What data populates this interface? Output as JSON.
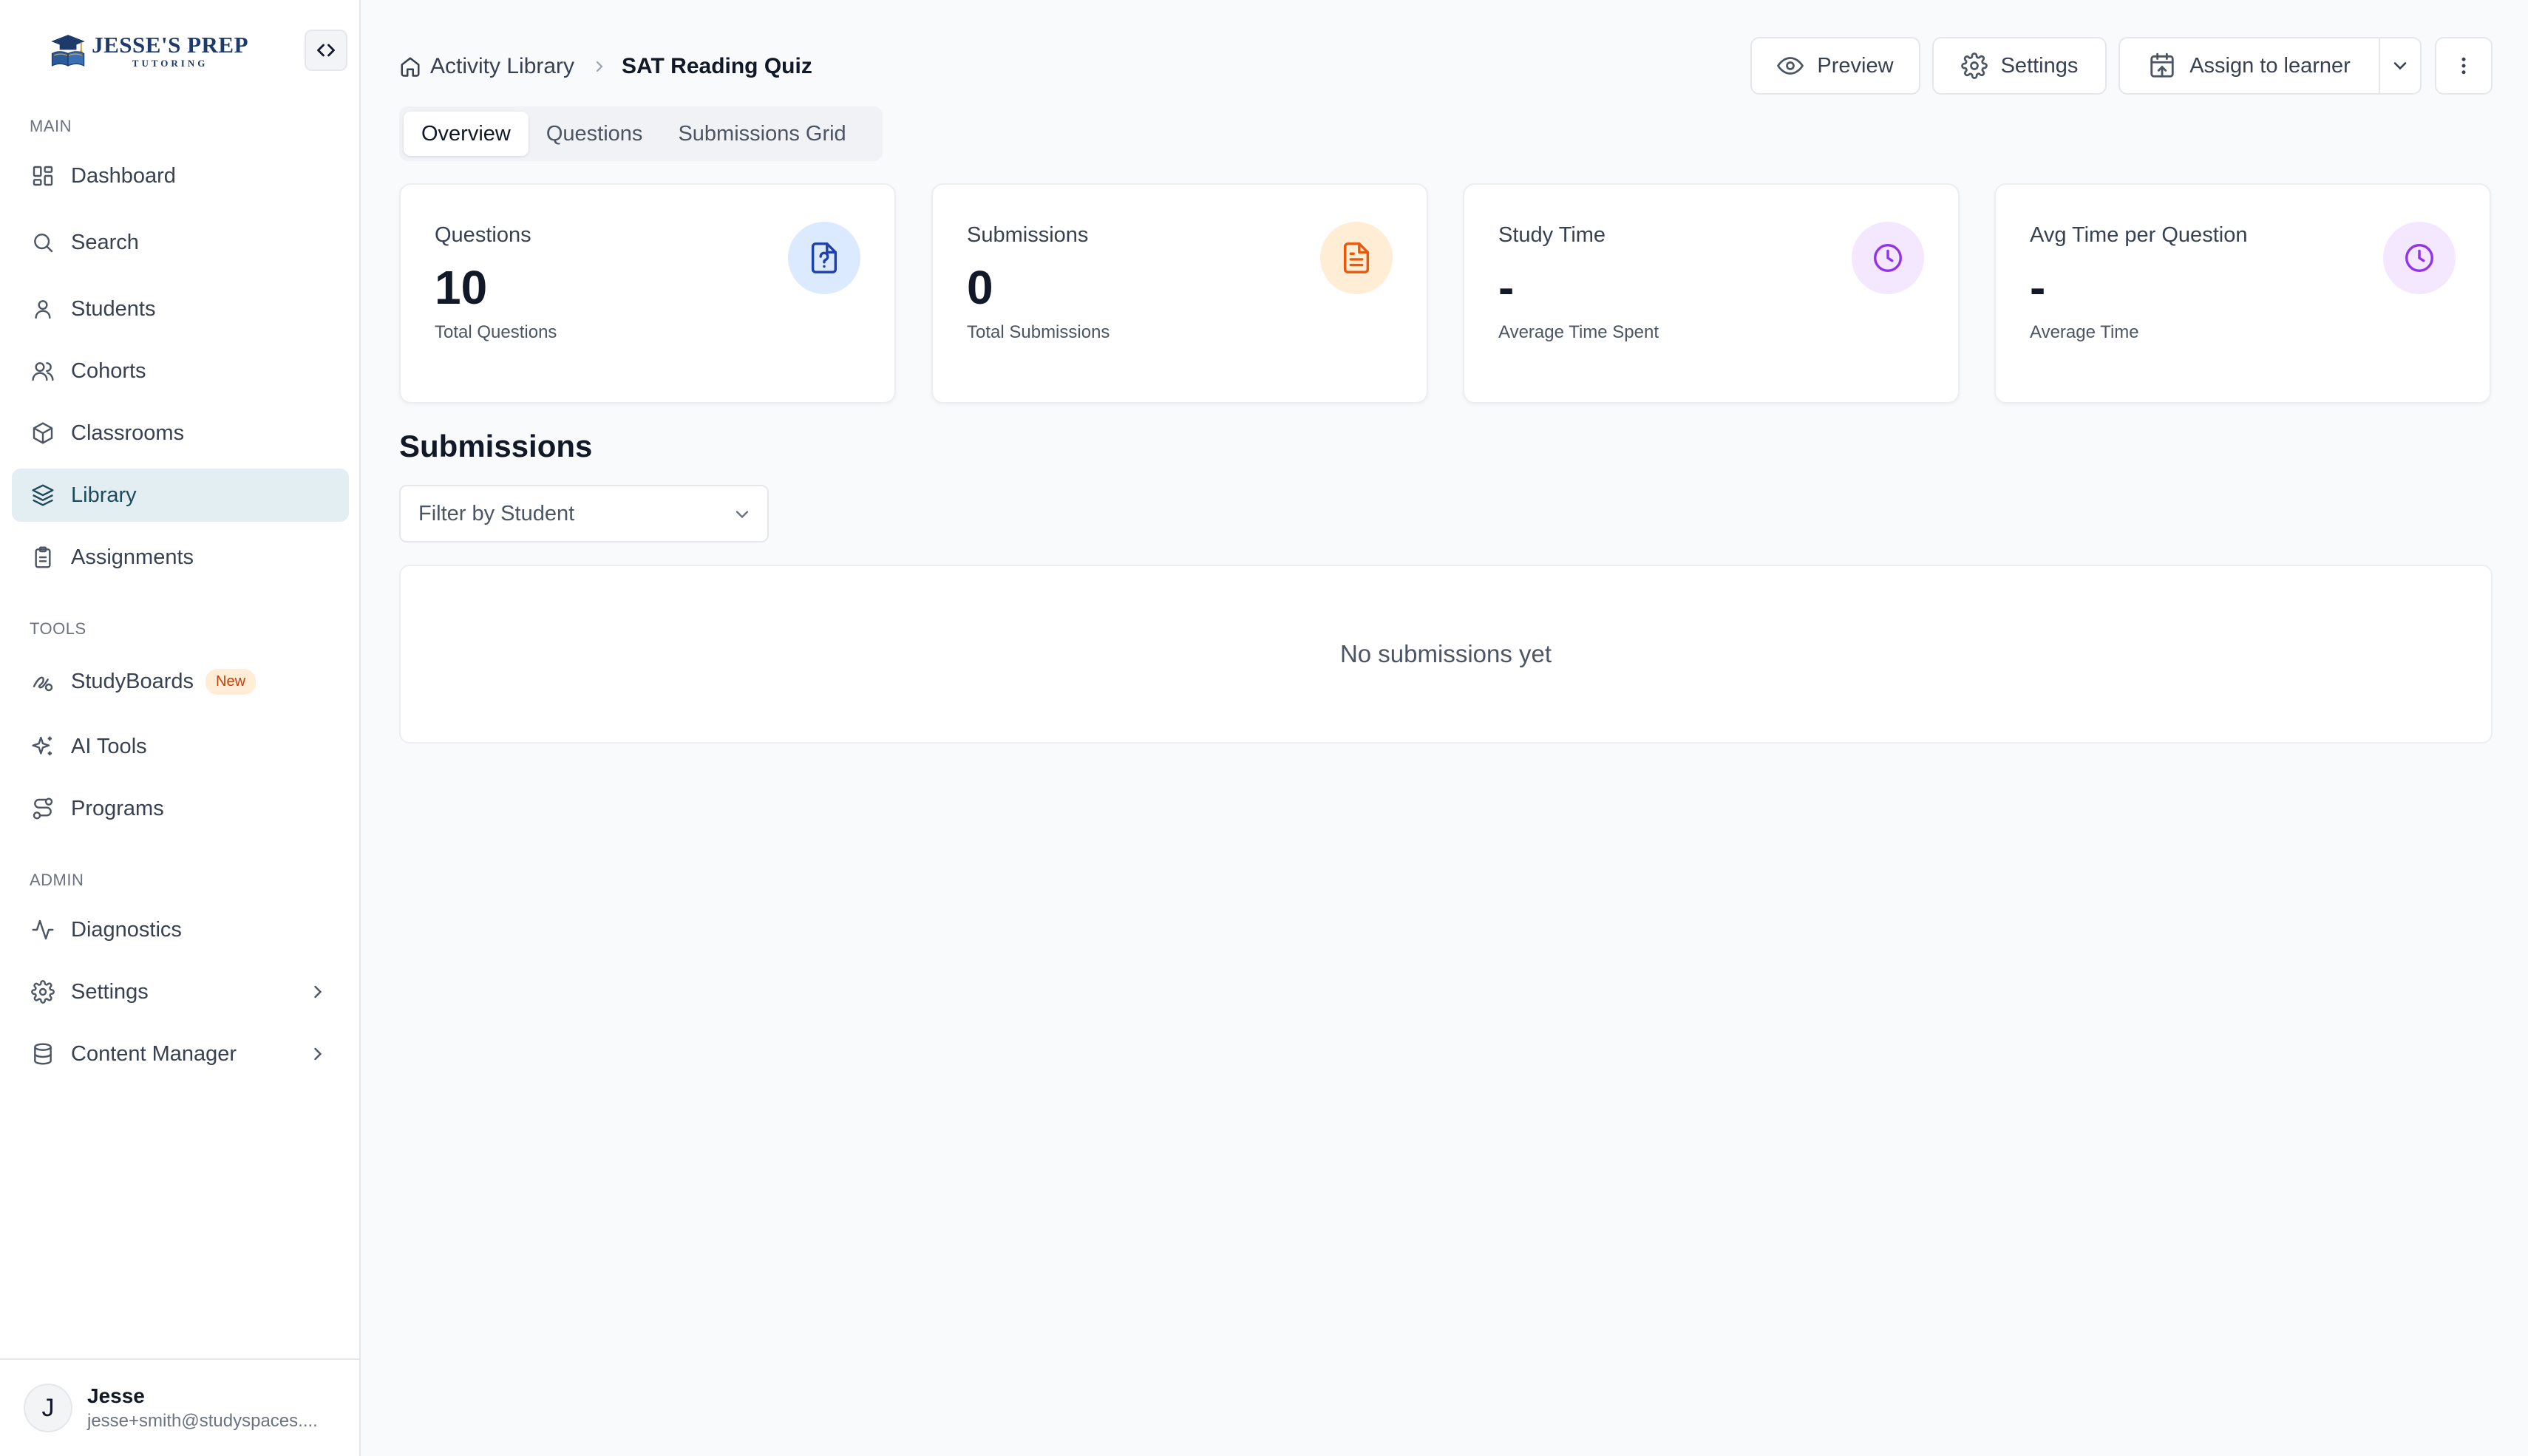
{
  "brand": {
    "title": "JESSE'S PREP",
    "subtitle": "TUTORING"
  },
  "sidebar": {
    "sections": {
      "main": "MAIN",
      "tools": "TOOLS",
      "admin": "ADMIN"
    },
    "main_items": [
      {
        "label": "Dashboard",
        "icon": "dashboard-icon"
      },
      {
        "label": "Search",
        "icon": "search-icon"
      },
      {
        "label": "Students",
        "icon": "user-icon"
      },
      {
        "label": "Cohorts",
        "icon": "users-icon"
      },
      {
        "label": "Classrooms",
        "icon": "cube-icon"
      },
      {
        "label": "Library",
        "icon": "layers-icon",
        "active": true
      },
      {
        "label": "Assignments",
        "icon": "clipboard-icon"
      }
    ],
    "tools_items": [
      {
        "label": "StudyBoards",
        "icon": "studyboards-icon",
        "badge": "New"
      },
      {
        "label": "AI Tools",
        "icon": "sparkles-icon"
      },
      {
        "label": "Programs",
        "icon": "route-icon"
      }
    ],
    "admin_items": [
      {
        "label": "Diagnostics",
        "icon": "activity-icon"
      },
      {
        "label": "Settings",
        "icon": "gear-icon"
      },
      {
        "label": "Content Manager",
        "icon": "database-icon"
      }
    ]
  },
  "user": {
    "initial": "J",
    "name": "Jesse",
    "email": "jesse+smith@studyspaces...."
  },
  "breadcrumb": {
    "parent": "Activity Library",
    "current": "SAT Reading Quiz"
  },
  "toolbar": {
    "preview": "Preview",
    "settings": "Settings",
    "assign": "Assign to learner"
  },
  "tabs": [
    "Overview",
    "Questions",
    "Submissions Grid"
  ],
  "active_tab": "Overview",
  "stats": [
    {
      "label": "Questions",
      "value": "10",
      "sub": "Total Questions",
      "icon": "question-file-icon",
      "color": "#1e40af",
      "bg": "#dbeafe"
    },
    {
      "label": "Submissions",
      "value": "0",
      "sub": "Total Submissions",
      "icon": "document-icon",
      "color": "#ea580c",
      "bg": "#ffedd5"
    },
    {
      "label": "Study Time",
      "value": "-",
      "sub": "Average Time Spent",
      "icon": "clock-icon",
      "color": "#9333ea",
      "bg": "#f3e8ff"
    },
    {
      "label": "Avg Time per Question",
      "value": "-",
      "sub": "Average Time",
      "icon": "clock-icon",
      "color": "#9333ea",
      "bg": "#f3e8ff"
    }
  ],
  "submissions": {
    "title": "Submissions",
    "filter_placeholder": "Filter by Student",
    "empty": "No submissions yet"
  },
  "colors": {
    "accent": "#1f4a5c",
    "active_bg": "#e3eef3"
  }
}
